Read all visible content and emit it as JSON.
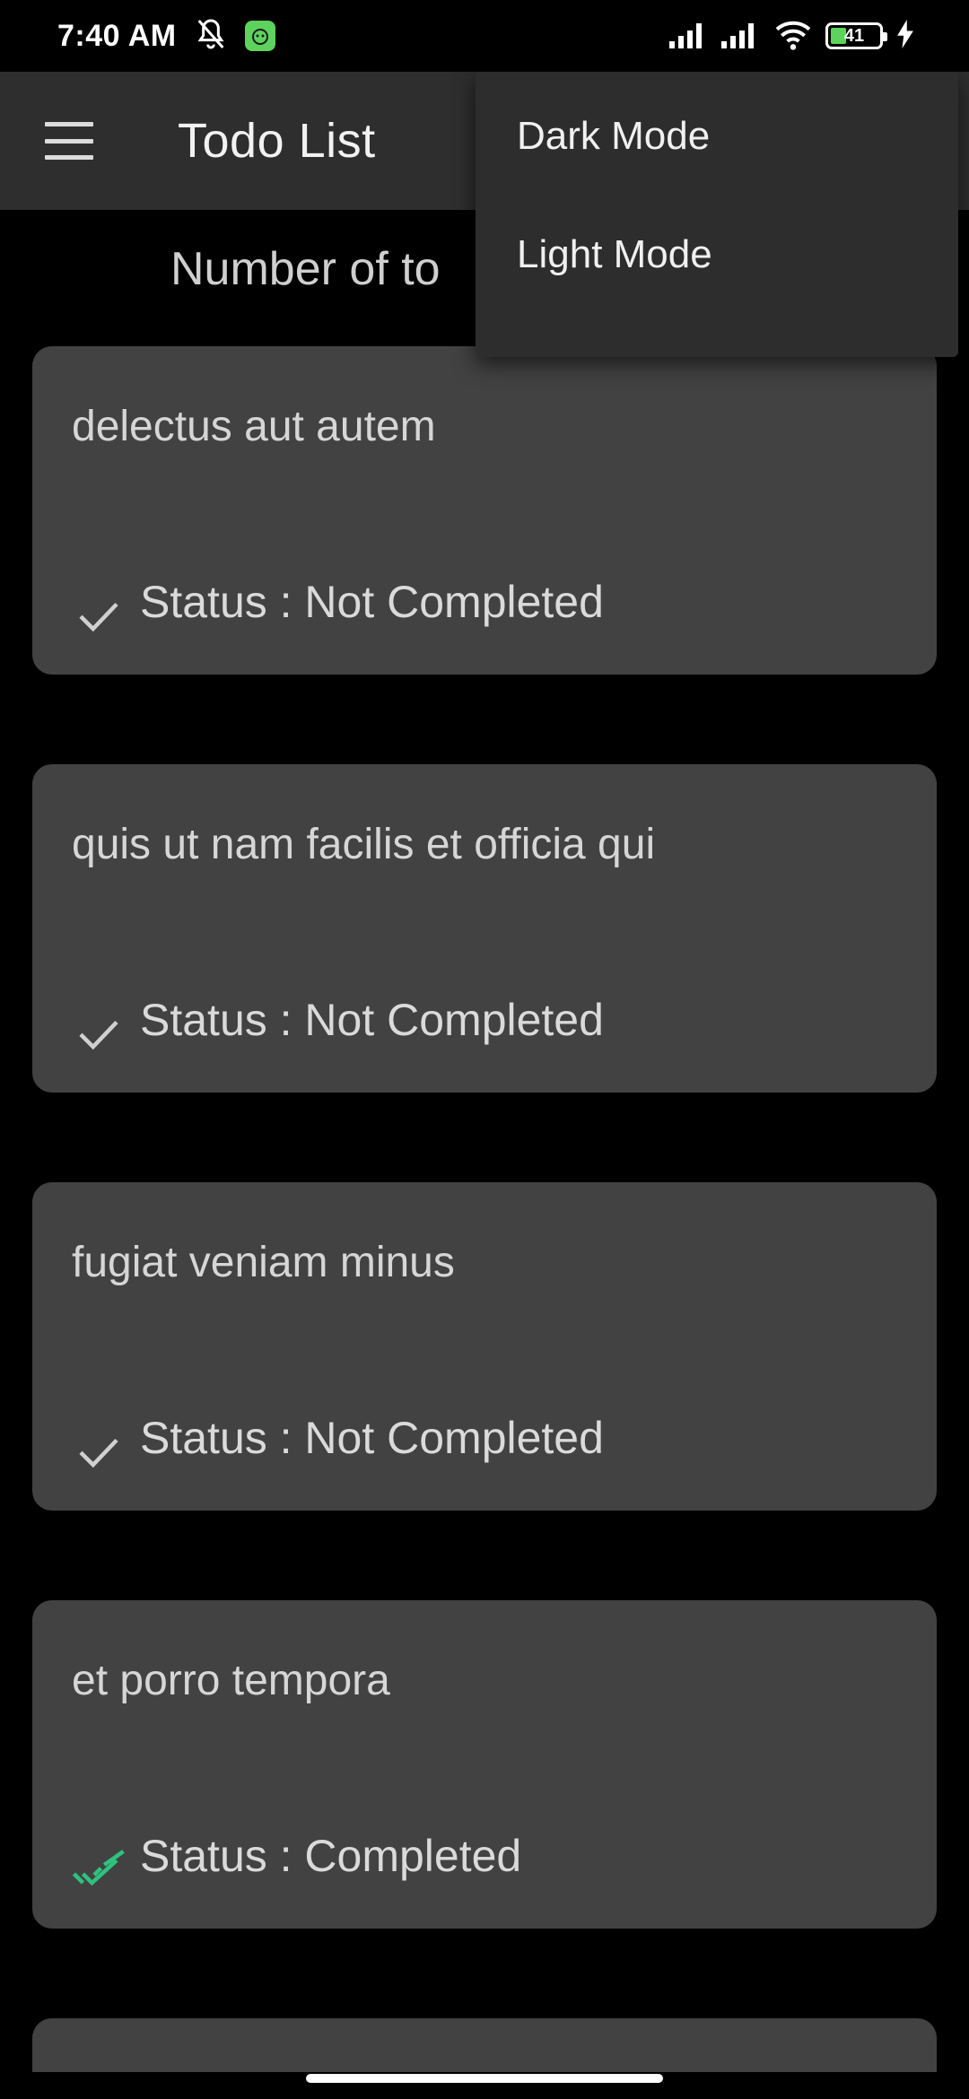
{
  "status_bar": {
    "time": "7:40 AM",
    "battery_level": "41",
    "accent_color": "#5dd35d"
  },
  "app_bar": {
    "title": "Todo List",
    "menu_icon": "hamburger-menu-icon"
  },
  "count_heading": "Number of to",
  "theme_menu": {
    "items": [
      {
        "label": "Dark Mode"
      },
      {
        "label": "Light Mode"
      }
    ]
  },
  "todos": [
    {
      "title": "delectus aut autem",
      "status": "Status : Not Completed",
      "completed": false
    },
    {
      "title": "quis ut nam facilis et officia qui",
      "status": "Status : Not Completed",
      "completed": false
    },
    {
      "title": "fugiat veniam minus",
      "status": "Status : Not Completed",
      "completed": false
    },
    {
      "title": "et porro tempora",
      "status": "Status : Completed",
      "completed": true
    }
  ],
  "colors": {
    "completed_check": "#2ec27e",
    "pending_check": "#d0d0d0",
    "card_bg": "#424242",
    "app_bar_bg": "#2e2e2e"
  }
}
